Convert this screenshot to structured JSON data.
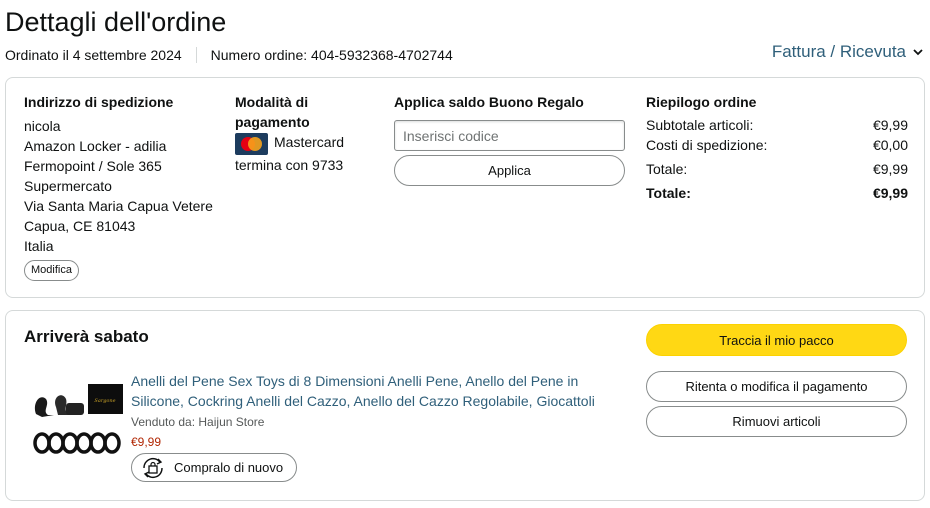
{
  "header": {
    "title": "Dettagli dell'ordine",
    "ordered": "Ordinato il 4 settembre 2024",
    "order_number": "Numero ordine: 404-5932368-4702744",
    "invoice_link": "Fattura / Ricevuta"
  },
  "shipping": {
    "heading": "Indirizzo di spedizione",
    "lines": [
      "nicola",
      "Amazon Locker - adilia",
      "Fermopoint / Sole 365",
      "Supermercato",
      "Via Santa Maria Capua Vetere",
      "Capua, CE 81043",
      "Italia"
    ],
    "edit_label": "Modifica"
  },
  "payment": {
    "heading_line1": "Modalità di",
    "heading_line2": "pagamento",
    "card_name": "Mastercard",
    "card_ending": "termina con 9733",
    "card_icon": "mastercard-icon"
  },
  "gift": {
    "heading": "Applica saldo Buono Regalo",
    "placeholder": "Inserisci codice",
    "apply_label": "Applica"
  },
  "summary": {
    "heading": "Riepilogo ordine",
    "rows": [
      {
        "label": "Subtotale articoli:",
        "value": "€9,99"
      },
      {
        "label": "Costi di spedizione:",
        "value": "€0,00"
      },
      {
        "label": "Totale:",
        "value": "€9,99"
      },
      {
        "label": "Totale:",
        "value": "€9,99"
      }
    ]
  },
  "shipment": {
    "status": "Arriverà sabato",
    "track_label": "Traccia il mio pacco",
    "retry_label": "Ritenta o modifica il pagamento",
    "remove_label": "Rimuovi articoli",
    "product": {
      "title": "Anelli del Pene Sex Toys di 8 Dimensioni Anelli Pene, Anello del Pene in Silicone, Cockring Anelli del Cazzo, Anello del Cazzo Regolabile, Giocattoli",
      "seller": "Venduto da: Haijun Store",
      "price": "€9,99",
      "buy_again_label": "Compralo di nuovo"
    }
  },
  "colors": {
    "link": "#2f5f7a",
    "price": "#b12704",
    "track_button": "#ffd814",
    "border": "#d5d9d9"
  }
}
